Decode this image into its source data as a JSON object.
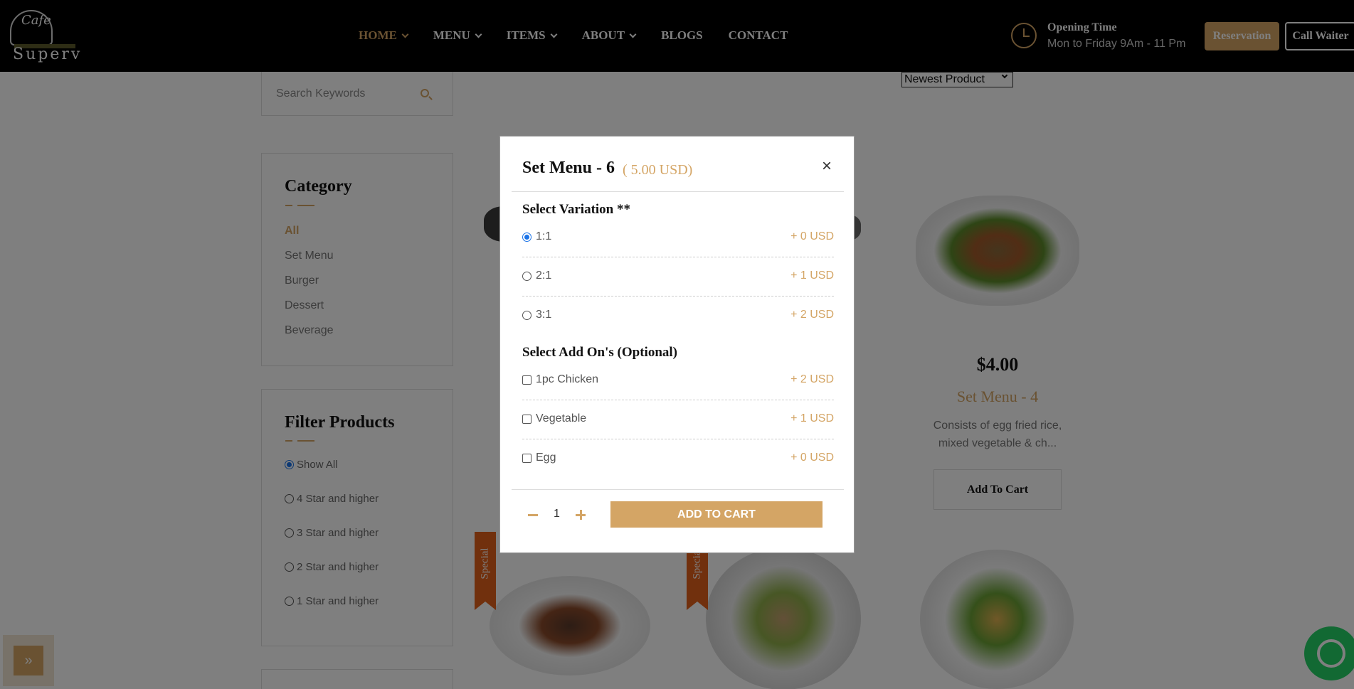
{
  "header": {
    "logo_script": "Cafe",
    "logo_name": "Superv",
    "nav": [
      {
        "label": "HOME",
        "dropdown": true,
        "active": true
      },
      {
        "label": "MENU",
        "dropdown": true
      },
      {
        "label": "ITEMS",
        "dropdown": true
      },
      {
        "label": "ABOUT",
        "dropdown": true
      },
      {
        "label": "BLOGS",
        "dropdown": false
      },
      {
        "label": "CONTACT",
        "dropdown": false
      }
    ],
    "opening_title": "Opening Time",
    "opening_hours": "Mon to Friday 9Am - 11 Pm",
    "reservation_label": "Reservation",
    "call_waiter_label": "Call Waiter"
  },
  "sort": {
    "selected": "Newest Product"
  },
  "search": {
    "placeholder": "Search Keywords"
  },
  "category": {
    "title": "Category",
    "items": [
      {
        "label": "All",
        "active": true
      },
      {
        "label": "Set Menu"
      },
      {
        "label": "Burger"
      },
      {
        "label": "Dessert"
      },
      {
        "label": "Beverage"
      }
    ]
  },
  "filter": {
    "title": "Filter Products",
    "options": [
      {
        "label": "Show All",
        "checked": true
      },
      {
        "label": "4 Star and higher"
      },
      {
        "label": "3 Star and higher"
      },
      {
        "label": "2 Star and higher"
      },
      {
        "label": "1 Star and higher"
      }
    ]
  },
  "product": {
    "price": "$4.00",
    "name": "Set Menu - 4",
    "description_line1": "Consists of egg fried rice,",
    "description_line2": "mixed vegetable & ch...",
    "button": "Add To Cart"
  },
  "ribbon_label": "Special",
  "modal": {
    "title": "Set Menu - 6",
    "price": "( 5.00 USD)",
    "close": "×",
    "variation_title": "Select Variation **",
    "variations": [
      {
        "label": "1:1",
        "price": "+ 0 USD",
        "checked": true
      },
      {
        "label": "2:1",
        "price": "+ 1 USD"
      },
      {
        "label": "3:1",
        "price": "+ 2 USD"
      }
    ],
    "addons_title": "Select Add On's (Optional)",
    "addons": [
      {
        "label": "1pc Chicken",
        "price": "+ 2 USD"
      },
      {
        "label": "Vegetable",
        "price": "+ 1 USD"
      },
      {
        "label": "Egg",
        "price": "+ 0 USD"
      }
    ],
    "quantity": "1",
    "add_button": "ADD TO CART"
  },
  "colors": {
    "accent": "#d4a565",
    "ribbon": "#e2601b",
    "whatsapp": "#25d366"
  },
  "icons": [
    "search-icon",
    "clock-icon",
    "chevron-down-icon",
    "close-icon",
    "minus-icon",
    "plus-icon",
    "double-chevron-up-icon",
    "whatsapp-icon"
  ]
}
